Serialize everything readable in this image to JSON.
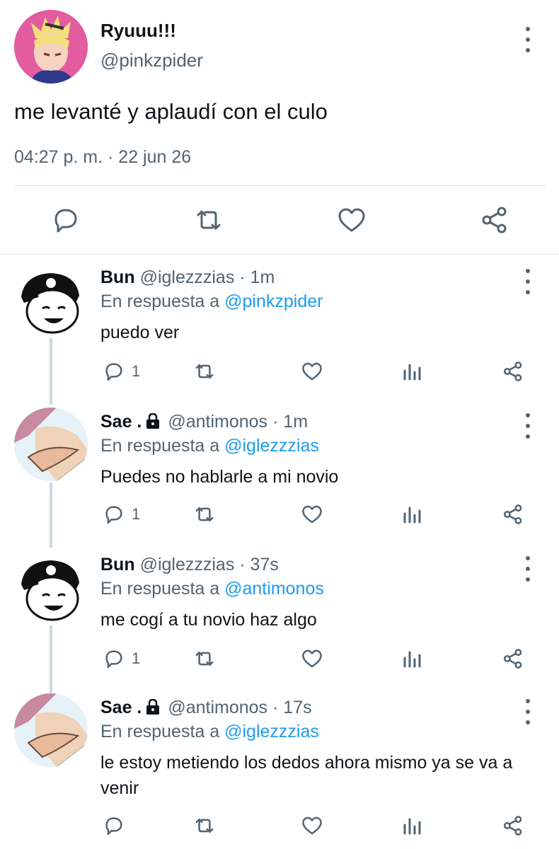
{
  "main_tweet": {
    "name": "Ryuuu!!!",
    "handle": "@pinkzpider",
    "text": "me levanté y aplaudí con el culo",
    "meta": "04:27 p. m. · 22 jun 26"
  },
  "replies": [
    {
      "name": "Bun",
      "handle": "@iglezzzias",
      "time": "· 1m",
      "reply_prefix": "En respuesta a",
      "reply_to": "@pinkzpider",
      "text": "puedo ver",
      "reply_count": "1"
    },
    {
      "name": "Sae .",
      "handle": "@antimonos",
      "time": "· 1m",
      "reply_prefix": "En respuesta a",
      "reply_to": "@iglezzzias",
      "text": "Puedes no hablarle a mi novio",
      "reply_count": "1"
    },
    {
      "name": "Bun",
      "handle": "@iglezzzias",
      "time": "· 37s",
      "reply_prefix": "En respuesta a",
      "reply_to": "@antimonos",
      "text": "me cogí a tu novio haz algo",
      "reply_count": "1"
    },
    {
      "name": "Sae .",
      "handle": "@antimonos",
      "time": "· 17s",
      "reply_prefix": "En respuesta a",
      "reply_to": "@iglezzzias",
      "text": "le estoy metiendo los dedos ahora mismo ya se va a venir",
      "reply_count": ""
    }
  ],
  "icons": {
    "reply": "reply-icon",
    "retweet": "retweet-icon",
    "like": "like-icon",
    "share": "share-icon",
    "analytics": "analytics-icon",
    "more": "more-vertical-icon",
    "lock": "lock-icon"
  },
  "colors": {
    "text": "#0f1419",
    "muted": "#536471",
    "link": "#1d9bf0",
    "divider": "#cfd9de"
  }
}
